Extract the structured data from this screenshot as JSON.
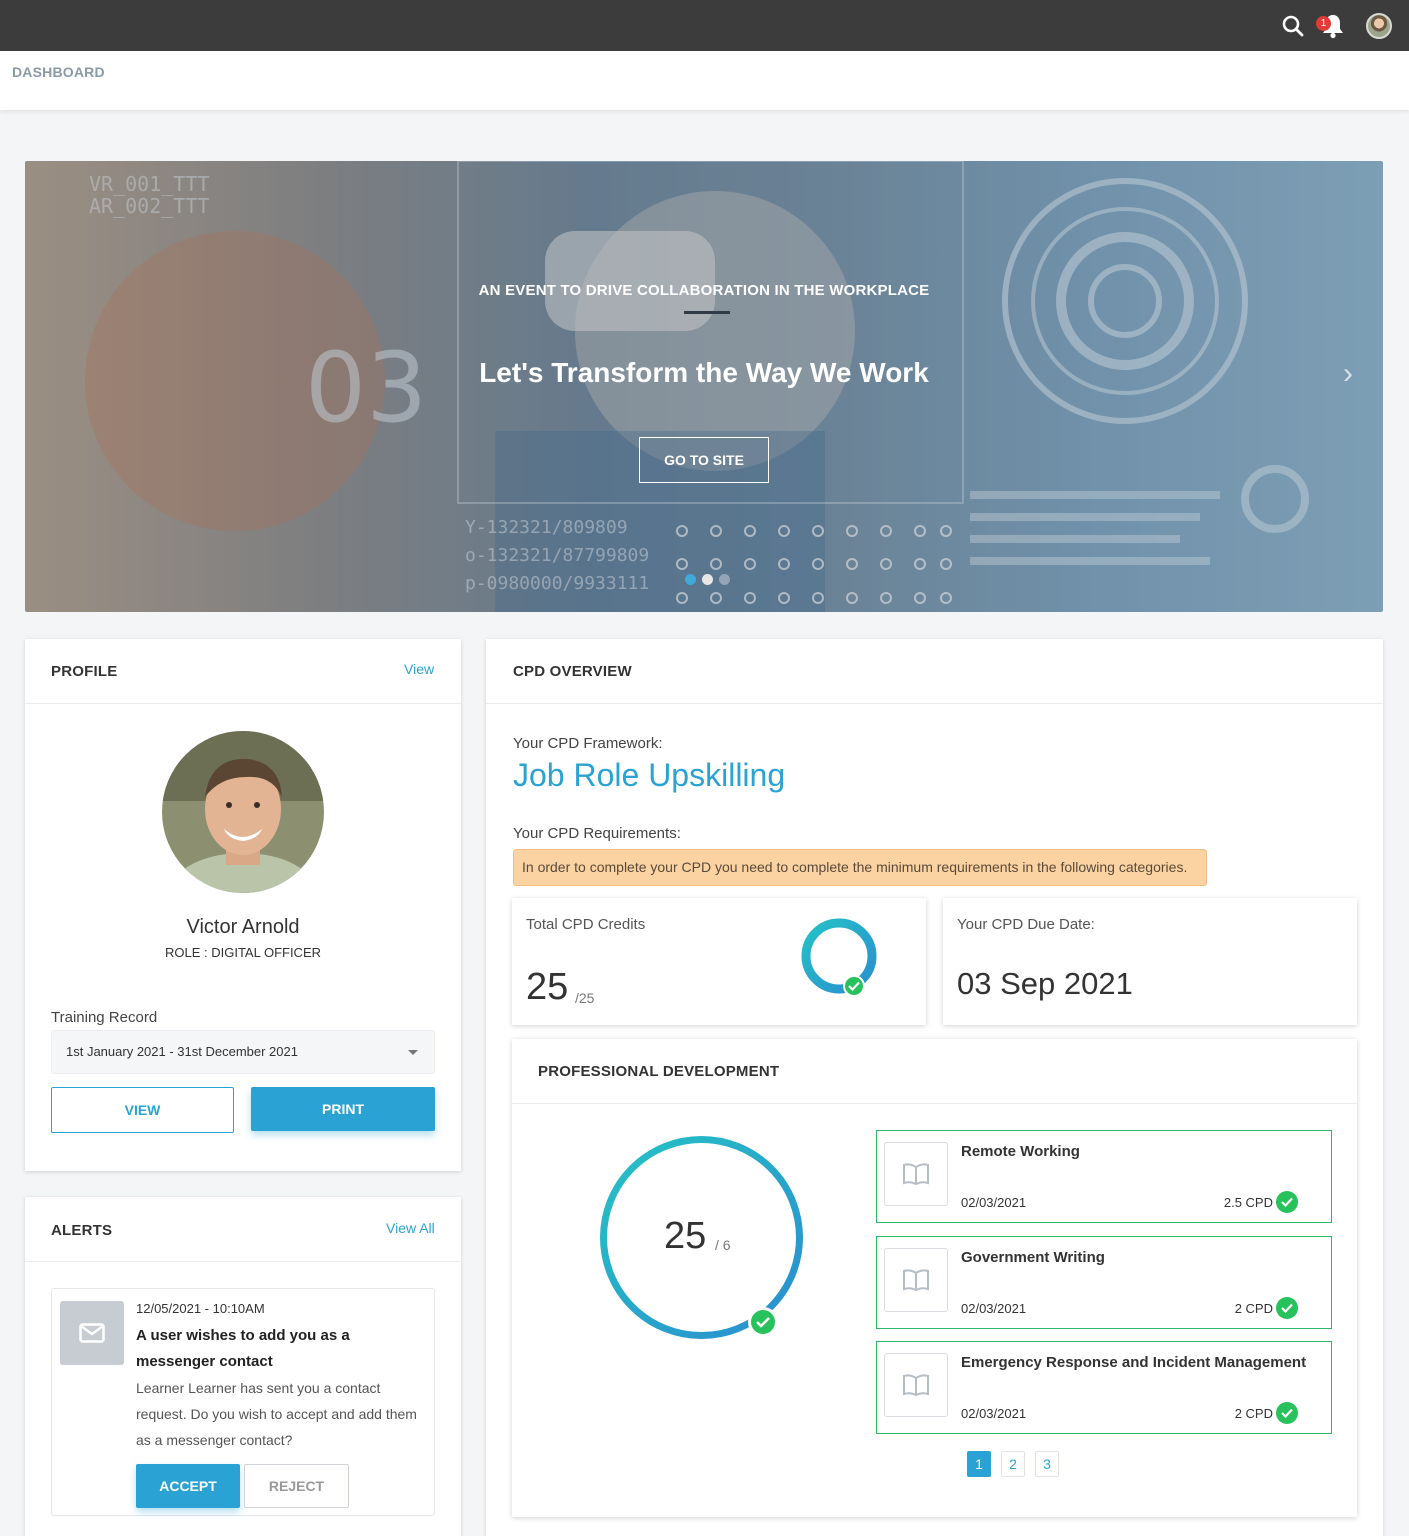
{
  "topbar": {
    "notification_count": "1"
  },
  "breadcrumb": "DASHBOARD",
  "banner": {
    "kicker": "AN EVENT TO DRIVE COLLABORATION IN THE WORKPLACE",
    "title": "Let's Transform the Way We Work",
    "button": "GO TO SITE",
    "next_arrow": "›",
    "slide_count": 3,
    "active_slide": 1
  },
  "profile": {
    "title": "PROFILE",
    "view_link": "View",
    "name": "Victor Arnold",
    "role": "ROLE : DIGITAL OFFICER",
    "training_label": "Training Record",
    "training_period": "1st January 2021 - 31st December 2021",
    "view_button": "VIEW",
    "print_button": "PRINT"
  },
  "alerts": {
    "title": "ALERTS",
    "view_all": "View All",
    "items": [
      {
        "datetime": "12/05/2021 - 10:10AM",
        "title": "A user wishes to add you as a messenger contact",
        "body": "Learner Learner has sent you a contact request. Do you wish to accept and add them as a messenger contact?",
        "accept": "ACCEPT",
        "reject": "REJECT",
        "icon": "envelope-icon"
      }
    ]
  },
  "cpd": {
    "title": "CPD OVERVIEW",
    "framework_label": "Your CPD Framework:",
    "framework": "Job Role Upskilling",
    "requirements_label": "Your CPD Requirements:",
    "requirements_note": "In order to complete your CPD you need to complete the minimum requirements in the following categories.",
    "total_label": "Total CPD Credits",
    "total_value": "25",
    "total_target": "/25",
    "due_label": "Your CPD Due Date:",
    "due_date": "03 Sep 2021"
  },
  "pd": {
    "title": "PROFESSIONAL DEVELOPMENT",
    "value": "25",
    "target": "/ 6",
    "courses": [
      {
        "title": "Remote Working",
        "date": "02/03/2021",
        "cpd": "2.5 CPD"
      },
      {
        "title": "Government Writing",
        "date": "02/03/2021",
        "cpd": "2 CPD"
      },
      {
        "title": "Emergency Response and Incident Management",
        "date": "02/03/2021",
        "cpd": "2 CPD"
      }
    ],
    "pages": [
      "1",
      "2",
      "3"
    ],
    "active_page": "1"
  },
  "colors": {
    "accent": "#29a3d3",
    "success": "#27c25b",
    "warning_bg": "#fbd3a3",
    "topbar": "#3c3c3c"
  }
}
